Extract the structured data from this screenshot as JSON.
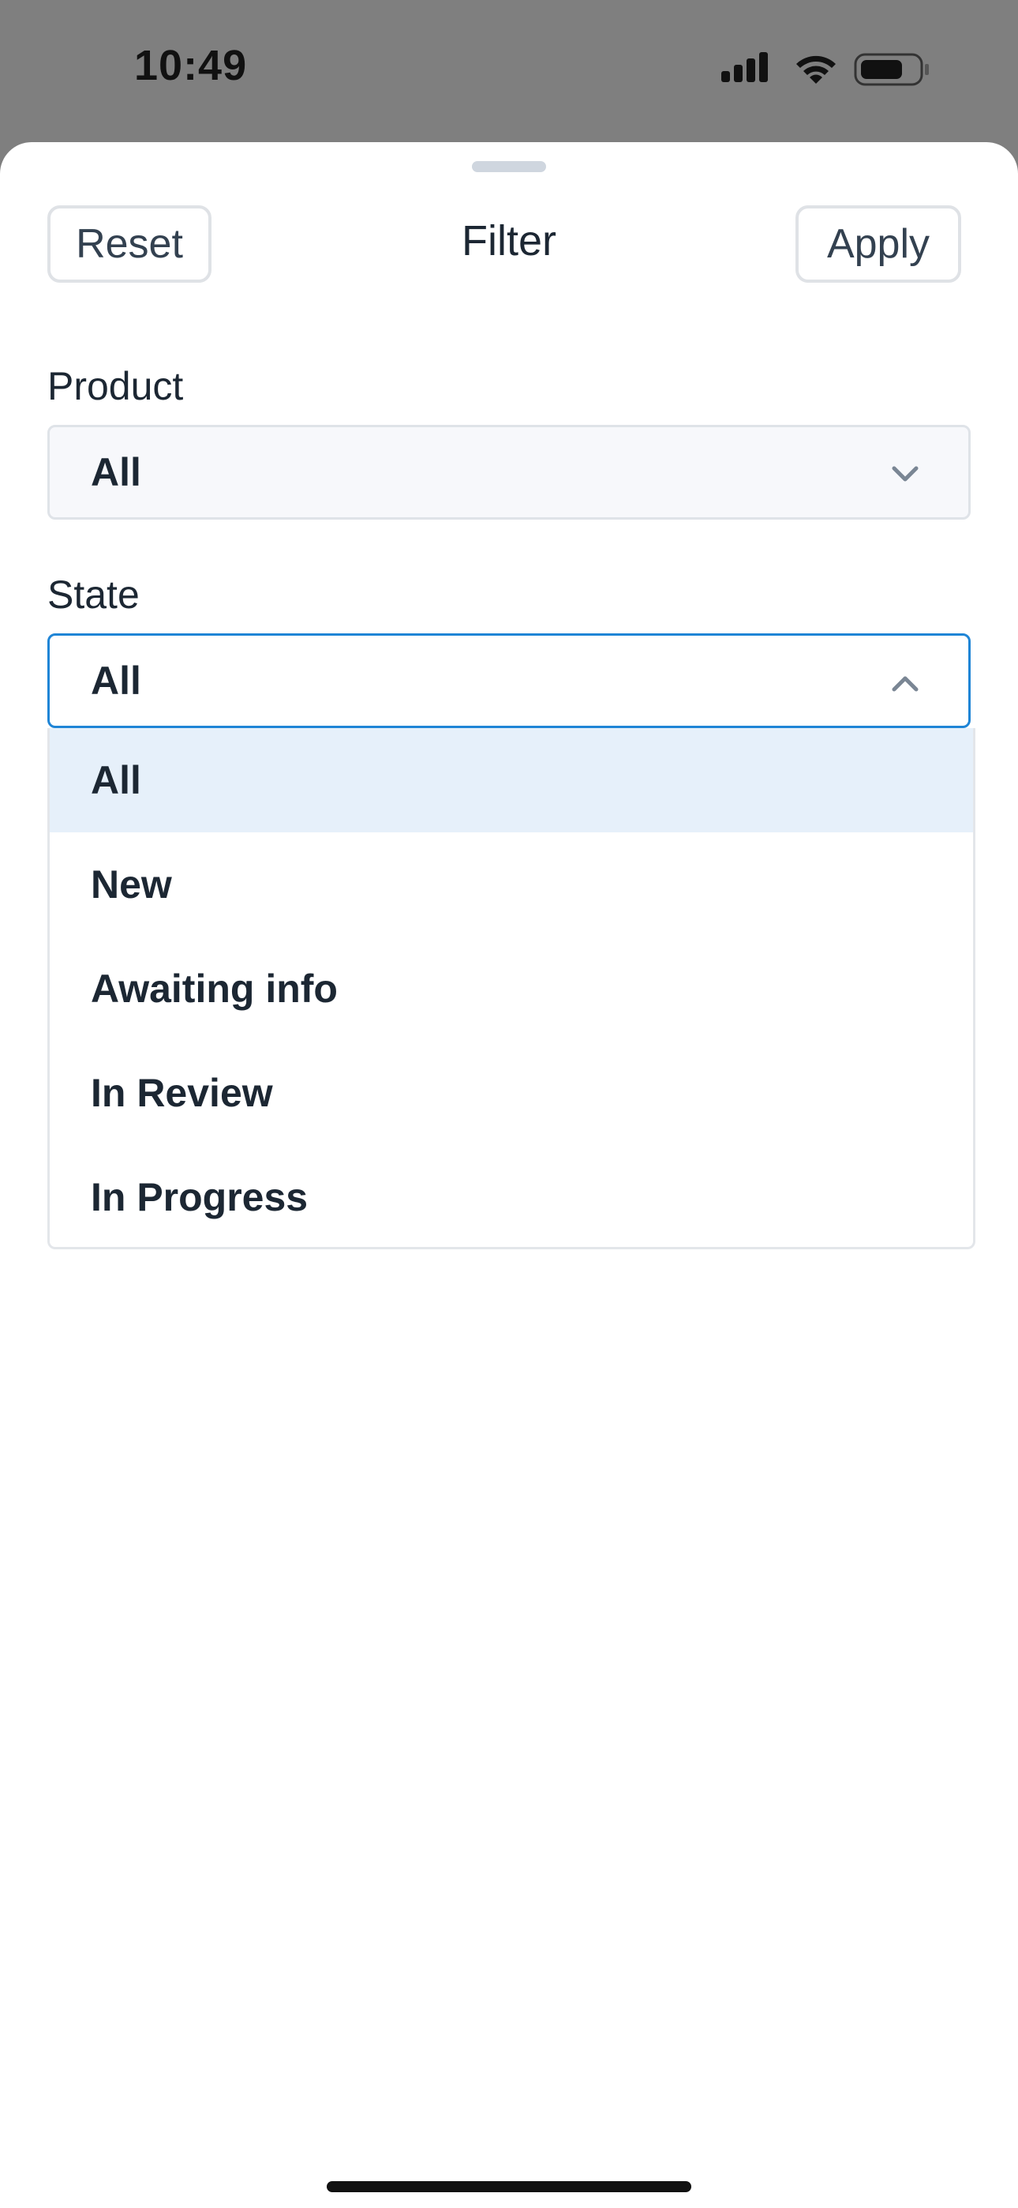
{
  "status_bar": {
    "time": "10:49"
  },
  "header": {
    "reset_label": "Reset",
    "title": "Filter",
    "apply_label": "Apply"
  },
  "product": {
    "label": "Product",
    "value": "All"
  },
  "state": {
    "label": "State",
    "value": "All",
    "options": [
      "All",
      "New",
      "Awaiting info",
      "In Review",
      "In Progress"
    ]
  },
  "colors": {
    "accent": "#1f85d6",
    "selected_option_bg": "#e6f0fa",
    "text": "#1c2733"
  }
}
